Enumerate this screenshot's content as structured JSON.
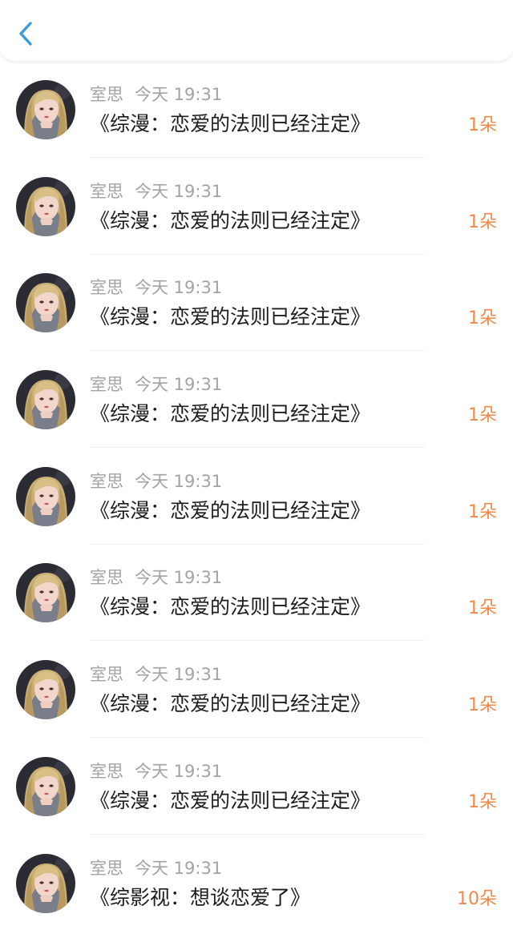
{
  "header": {
    "back_icon": "chevron-left-icon",
    "accent": "#3a9bdc"
  },
  "colors": {
    "count": "#f0894a",
    "meta": "#a3a3a3",
    "title": "#1c1c1c"
  },
  "items": [
    {
      "name": "室思",
      "time": "今天 19:31",
      "title": "《综漫：恋爱的法则已经注定》",
      "count": "1朵"
    },
    {
      "name": "室思",
      "time": "今天 19:31",
      "title": "《综漫：恋爱的法则已经注定》",
      "count": "1朵"
    },
    {
      "name": "室思",
      "time": "今天 19:31",
      "title": "《综漫：恋爱的法则已经注定》",
      "count": "1朵"
    },
    {
      "name": "室思",
      "time": "今天 19:31",
      "title": "《综漫：恋爱的法则已经注定》",
      "count": "1朵"
    },
    {
      "name": "室思",
      "time": "今天 19:31",
      "title": "《综漫：恋爱的法则已经注定》",
      "count": "1朵"
    },
    {
      "name": "室思",
      "time": "今天 19:31",
      "title": "《综漫：恋爱的法则已经注定》",
      "count": "1朵"
    },
    {
      "name": "室思",
      "time": "今天 19:31",
      "title": "《综漫：恋爱的法则已经注定》",
      "count": "1朵"
    },
    {
      "name": "室思",
      "time": "今天 19:31",
      "title": "《综漫：恋爱的法则已经注定》",
      "count": "1朵"
    },
    {
      "name": "室思",
      "time": "今天 19:31",
      "title": "《综影视：想谈恋爱了》",
      "count": "10朵"
    }
  ]
}
